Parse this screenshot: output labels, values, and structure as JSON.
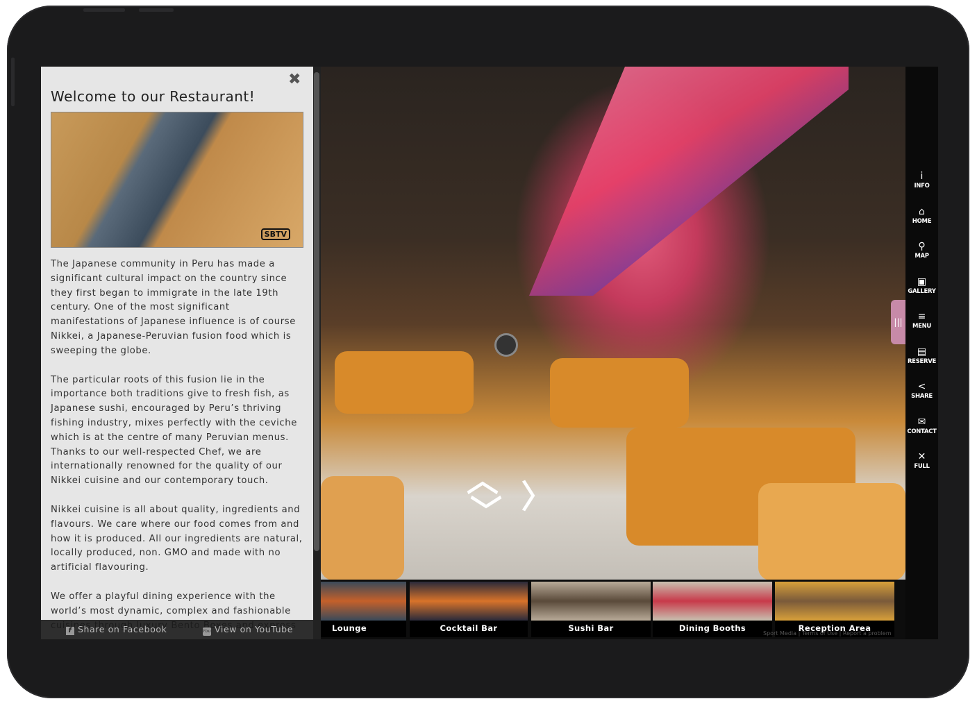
{
  "panel": {
    "title": "Welcome to our Restaurant!",
    "image_logo": "SBTV",
    "paragraphs": [
      "The Japanese community in Peru has made a significant cultural impact on the country since they first began to immigrate in the late 19th century. One of the most significant manifestations of Japanese influence is of course Nikkei, a Japanese-Peruvian fusion food which is sweeping the globe.",
      "The particular roots of this fusion lie in the importance both traditions give to fresh fish, as Japanese sushi, encouraged by Peru’s thriving fishing industry, mixes perfectly with the ceviche which is at the centre of many Peruvian menus. Thanks to our well-respected Chef, we are internationally renowned for the quality of our Nikkei cuisine and our contemporary touch.",
      "Nikkei cuisine is all about quality, ingredients and flavours. We care where our food comes from and how it is produced. All our ingredients are natural, locally produced, non. GMO and made with no artificial flavouring.",
      "We offer a playful dining experience with the world’s most dynamic, complex and fashionable cuisines through luxury Bento Boxes and express"
    ],
    "share_facebook": "Share on Facebook",
    "view_youtube": "View on YouTube"
  },
  "sidebar": [
    {
      "icon": "info-icon",
      "glyph": "i",
      "label": "INFO"
    },
    {
      "icon": "home-icon",
      "glyph": "⌂",
      "label": "HOME"
    },
    {
      "icon": "map-pin-icon",
      "glyph": "⚲",
      "label": "MAP"
    },
    {
      "icon": "gallery-icon",
      "glyph": "▣",
      "label": "GALLERY"
    },
    {
      "icon": "menu-icon",
      "glyph": "≡",
      "label": "MENU"
    },
    {
      "icon": "book-icon",
      "glyph": "▤",
      "label": "RESERVE"
    },
    {
      "icon": "share-icon",
      "glyph": "<",
      "label": "SHARE"
    },
    {
      "icon": "envelope-icon",
      "glyph": "✉",
      "label": "CONTACT"
    },
    {
      "icon": "fullscreen-icon",
      "glyph": "✕",
      "label": "FULL"
    }
  ],
  "thumbnails": [
    {
      "label": "Lounge",
      "colors": [
        "#c4602a",
        "#3a4a5a"
      ]
    },
    {
      "label": "Cocktail Bar",
      "colors": [
        "#d8732a",
        "#2a2a3a"
      ]
    },
    {
      "label": "Sushi Bar",
      "colors": [
        "#5a4a3a",
        "#b8aa98"
      ]
    },
    {
      "label": "Dining Booths",
      "colors": [
        "#c83a4a",
        "#c8c0b0"
      ]
    },
    {
      "label": "Reception Area",
      "colors": [
        "#7a5a3a",
        "#d8a03a"
      ]
    }
  ],
  "footer": "Sport Media | Terms of Use | Report a problem",
  "colors": {
    "handle": "#c78aa8",
    "sidebar": "#0a0a0a",
    "frame": "#1b1b1c"
  }
}
